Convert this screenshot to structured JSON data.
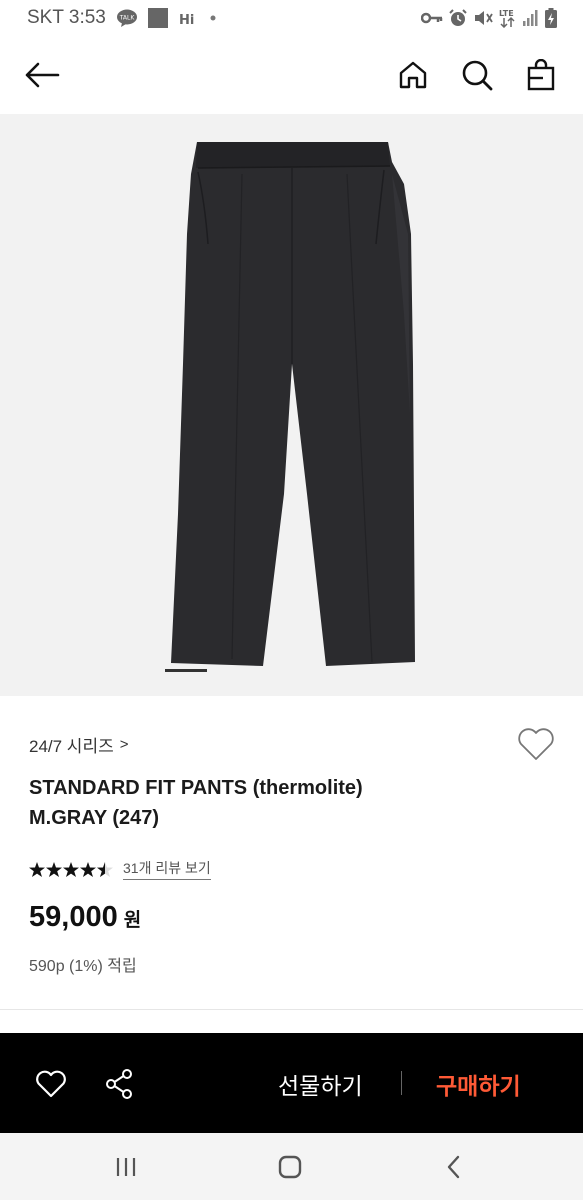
{
  "status_bar": {
    "carrier_time": "SKT 3:53",
    "network": "LTE",
    "icons": [
      "talk-icon",
      "square-icon",
      "hi-icon",
      "dot-icon",
      "key-icon",
      "alarm-icon",
      "mute-icon",
      "lte-icon",
      "signal-icon",
      "battery-icon"
    ]
  },
  "header": {
    "icons": [
      "back-arrow-icon",
      "home-icon",
      "search-icon",
      "shopping-bag-icon"
    ]
  },
  "product": {
    "series": "24/7 시리즈",
    "series_chevron": ">",
    "title_line1": "STANDARD FIT PANTS (thermolite)",
    "title_line2": "M.GRAY (247)",
    "rating": 4.5,
    "review_link": "31개 리뷰 보기",
    "price": "59,000",
    "price_unit": "원",
    "points": "590p (1%) 적립",
    "image_indicator": {
      "current": 1,
      "total": 1
    }
  },
  "action_bar": {
    "gift_label": "선물하기",
    "buy_label": "구매하기",
    "icons": [
      "heart-icon",
      "share-icon"
    ]
  },
  "system_nav": {
    "icons": [
      "recents-icon",
      "home-button-icon",
      "back-icon"
    ]
  },
  "colors": {
    "accent": "#ff5a36",
    "action_bar_bg": "#000000",
    "image_bg": "#f2f2f2",
    "garment": "#2b2b2e"
  }
}
